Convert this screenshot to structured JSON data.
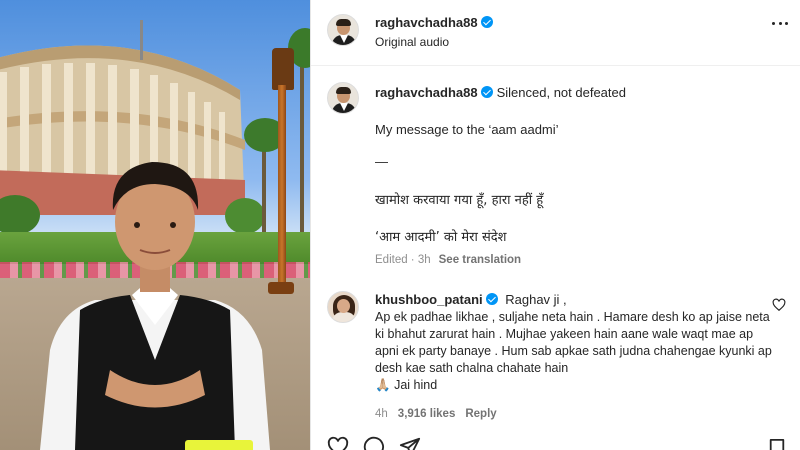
{
  "post": {
    "author": "raghavchadha88",
    "audio": "Original audio",
    "caption_inline": "Silenced, not defeated",
    "caption_lines": [
      "My message to the ‘aam aadmi’",
      "—",
      "खामोश करवाया गया हूँ, हारा नहीं हूँ",
      "‘आम आदमी’ को मेरा संदेश"
    ],
    "edited": "Edited · 3h",
    "see_translation": "See translation"
  },
  "comment": {
    "author": "khushboo_patani",
    "first_line": "Raghav ji ,",
    "body": "Ap ek padhae likhae , suljahe neta hain . Hamare desh ko ap jaise neta ki bhahut zarurat hain . Mujhae yakeen hain aane wale waqt mae ap apni ek party banaye . Hum sab apkae sath judna chahengae kyunki ap desh kae sath chalna chahate hain",
    "emoji": "🙏🏼",
    "sign_off": "Jai hind",
    "time": "4h",
    "likes": "3,916 likes",
    "reply": "Reply"
  },
  "colors": {
    "verified_blue": "#0095f6",
    "secondary_text": "#8e8e8e"
  },
  "icons": [
    "more-options-icon",
    "verified-badge-icon",
    "heart-icon",
    "comment-icon",
    "share-icon",
    "bookmark-icon"
  ]
}
